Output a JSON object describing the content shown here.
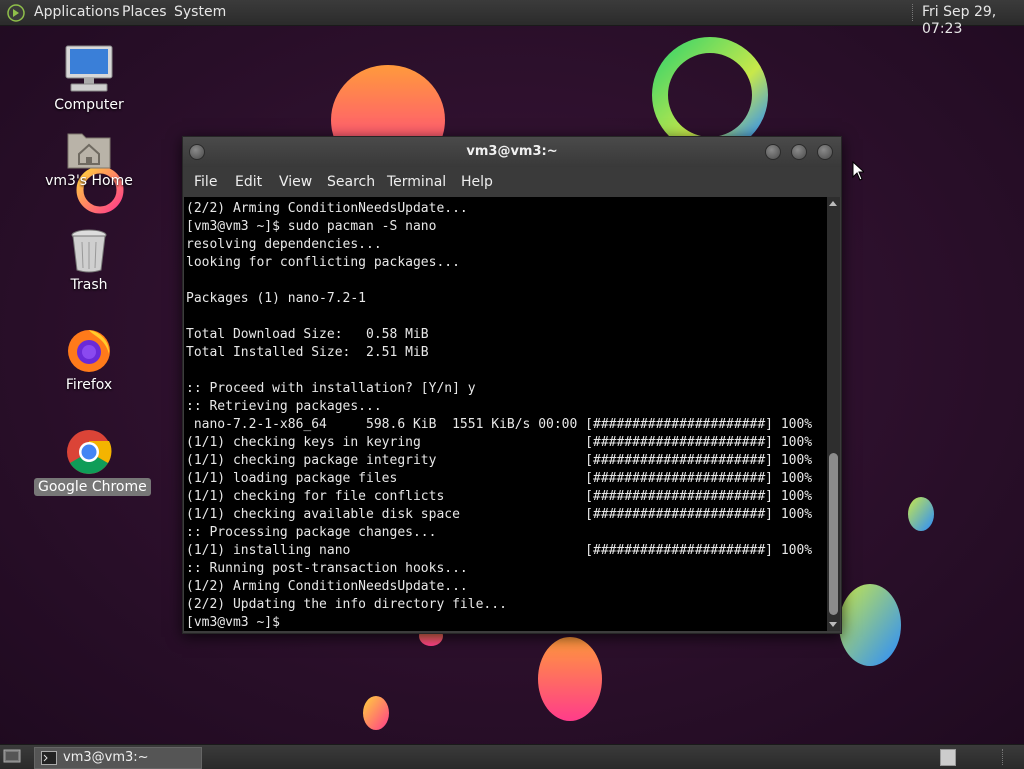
{
  "top_panel": {
    "menus": [
      "Applications",
      "Places",
      "System"
    ],
    "clock": "Fri Sep 29, 07:23"
  },
  "desktop": {
    "icons": [
      {
        "label": "Computer",
        "icon": "computer-icon"
      },
      {
        "label": "vm3's Home",
        "icon": "home-folder-icon"
      },
      {
        "label": "Trash",
        "icon": "trash-icon"
      },
      {
        "label": "Firefox",
        "icon": "firefox-icon"
      },
      {
        "label": "Google Chrome",
        "icon": "chrome-icon",
        "selected": true
      }
    ]
  },
  "terminal_window": {
    "title": "vm3@vm3:~",
    "menu": [
      "File",
      "Edit",
      "View",
      "Search",
      "Terminal",
      "Help"
    ],
    "lines": [
      "(2/2) Arming ConditionNeedsUpdate...",
      "[vm3@vm3 ~]$ sudo pacman -S nano",
      "resolving dependencies...",
      "looking for conflicting packages...",
      "",
      "Packages (1) nano-7.2-1",
      "",
      "Total Download Size:   0.58 MiB",
      "Total Installed Size:  2.51 MiB",
      "",
      ":: Proceed with installation? [Y/n] y",
      ":: Retrieving packages...",
      " nano-7.2-1-x86_64     598.6 KiB  1551 KiB/s 00:00 [######################] 100%",
      "(1/1) checking keys in keyring                     [######################] 100%",
      "(1/1) checking package integrity                   [######################] 100%",
      "(1/1) loading package files                        [######################] 100%",
      "(1/1) checking for file conflicts                  [######################] 100%",
      "(1/1) checking available disk space                [######################] 100%",
      ":: Processing package changes...",
      "(1/1) installing nano                              [######################] 100%",
      ":: Running post-transaction hooks...",
      "(1/2) Arming ConditionNeedsUpdate...",
      "(2/2) Updating the info directory file...",
      "[vm3@vm3 ~]$ "
    ]
  },
  "taskbar": {
    "window_button": "vm3@vm3:~"
  },
  "colors": {
    "wallpaper": "#2a0f2a",
    "panel": "#333333",
    "terminal_bg": "#000000"
  }
}
